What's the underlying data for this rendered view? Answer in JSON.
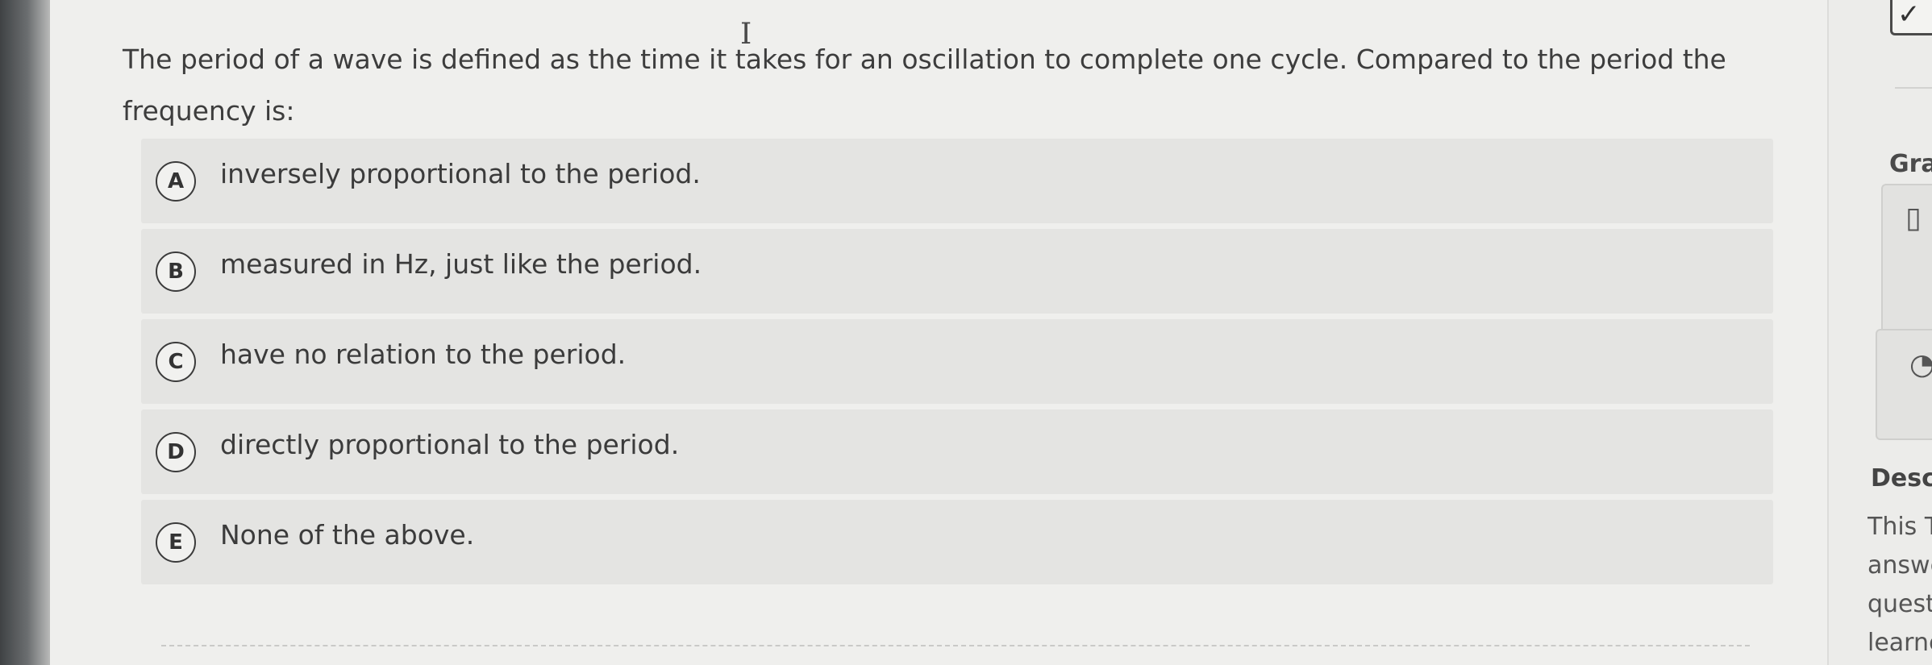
{
  "question": {
    "text": "The period of a wave is defined as the time it takes for an oscillation to complete one cycle. Compared to the period the frequency is:"
  },
  "options": [
    {
      "letter": "A",
      "text": "inversely proportional to the period."
    },
    {
      "letter": "B",
      "text": "measured in Hz, just like the period."
    },
    {
      "letter": "C",
      "text": "have no relation to the period."
    },
    {
      "letter": "D",
      "text": "directly proportional to the period."
    },
    {
      "letter": "E",
      "text": "None of the above."
    }
  ],
  "sidebar": {
    "check_glyph": "✓",
    "heading_1": "Gra",
    "heading_2": "Desc",
    "desc_lines": [
      "This T",
      "answe",
      "quest",
      "learne"
    ]
  },
  "icons": {
    "text_cursor": "text-cursor-icon",
    "checkmark": "checkmark-icon",
    "card_1": "document-icon",
    "card_2": "graph-icon"
  }
}
